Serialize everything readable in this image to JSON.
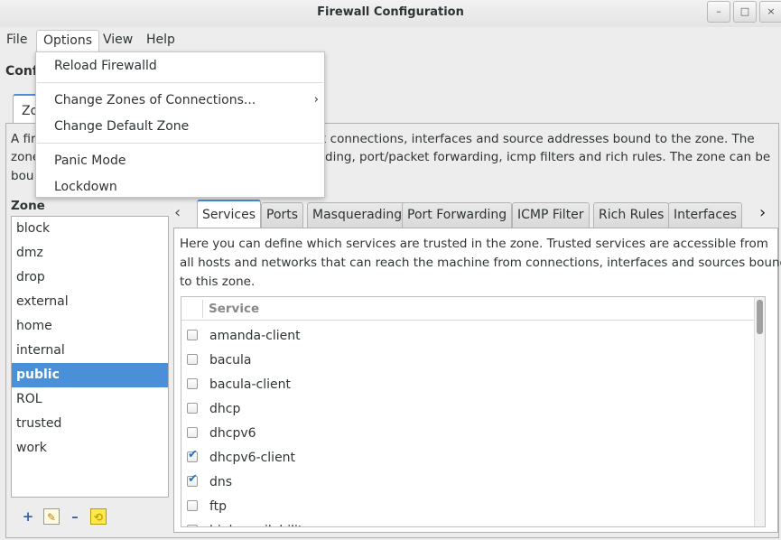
{
  "window": {
    "title": "Firewall Configuration",
    "controls": {
      "minimize": "–",
      "maximize": "□",
      "close": "×"
    }
  },
  "menubar": {
    "items": [
      "File",
      "Options",
      "View",
      "Help"
    ],
    "open_menu": "Options"
  },
  "options_menu": {
    "reload": "Reload Firewalld",
    "change_zones": "Change Zones of Connections...",
    "change_default": "Change Default Zone",
    "panic": "Panic Mode",
    "lockdown": "Lockdown",
    "submenu_glyph": "›"
  },
  "config_label": "Conf",
  "outer_tab_label": "Zo",
  "description": {
    "line1_a": "A fir",
    "line1_b": "rk connections, interfaces and source addresses bound to the zone. The",
    "line2_a": "zone",
    "line2_b": "ding, port/packet forwarding, icmp filters and rich rules. The zone can be",
    "line3_a": "bou"
  },
  "zones": {
    "label": "Zone",
    "items": [
      "block",
      "dmz",
      "drop",
      "external",
      "home",
      "internal",
      "public",
      "ROL",
      "trusted",
      "work"
    ],
    "selected": "public",
    "toolbar": {
      "add": "+",
      "edit": "✎",
      "remove": "–",
      "load_defaults": "⟲"
    }
  },
  "tabs": {
    "items": [
      "Services",
      "Ports",
      "Masquerading",
      "Port Forwarding",
      "ICMP Filter",
      "Rich Rules",
      "Interfaces"
    ],
    "active": "Services",
    "scroll_left": "‹",
    "scroll_right": "›"
  },
  "services": {
    "description_line1": "Here you can define which services are trusted in the zone. Trusted services are accessible from",
    "description_line2": "all hosts and networks that can reach the machine from connections, interfaces and sources bound",
    "description_line3": "to this zone.",
    "column_header": "Service",
    "check_glyph": "✔",
    "rows": [
      {
        "name": "amanda-client",
        "checked": false
      },
      {
        "name": "bacula",
        "checked": false
      },
      {
        "name": "bacula-client",
        "checked": false
      },
      {
        "name": "dhcp",
        "checked": false
      },
      {
        "name": "dhcpv6",
        "checked": false
      },
      {
        "name": "dhcpv6-client",
        "checked": true
      },
      {
        "name": "dns",
        "checked": true
      },
      {
        "name": "ftp",
        "checked": false
      },
      {
        "name": "high-availability",
        "checked": false
      }
    ]
  },
  "colors": {
    "accent": "#4a90d9",
    "check": "#2a6fbf"
  },
  "icons": {
    "add": "add-icon",
    "edit": "edit-icon",
    "remove": "remove-icon",
    "load_defaults": "load-defaults-icon",
    "checkbox": "checkbox-icon",
    "submenu": "chevron-right-icon",
    "tab_left": "chevron-left-icon",
    "tab_right": "chevron-right-icon"
  }
}
